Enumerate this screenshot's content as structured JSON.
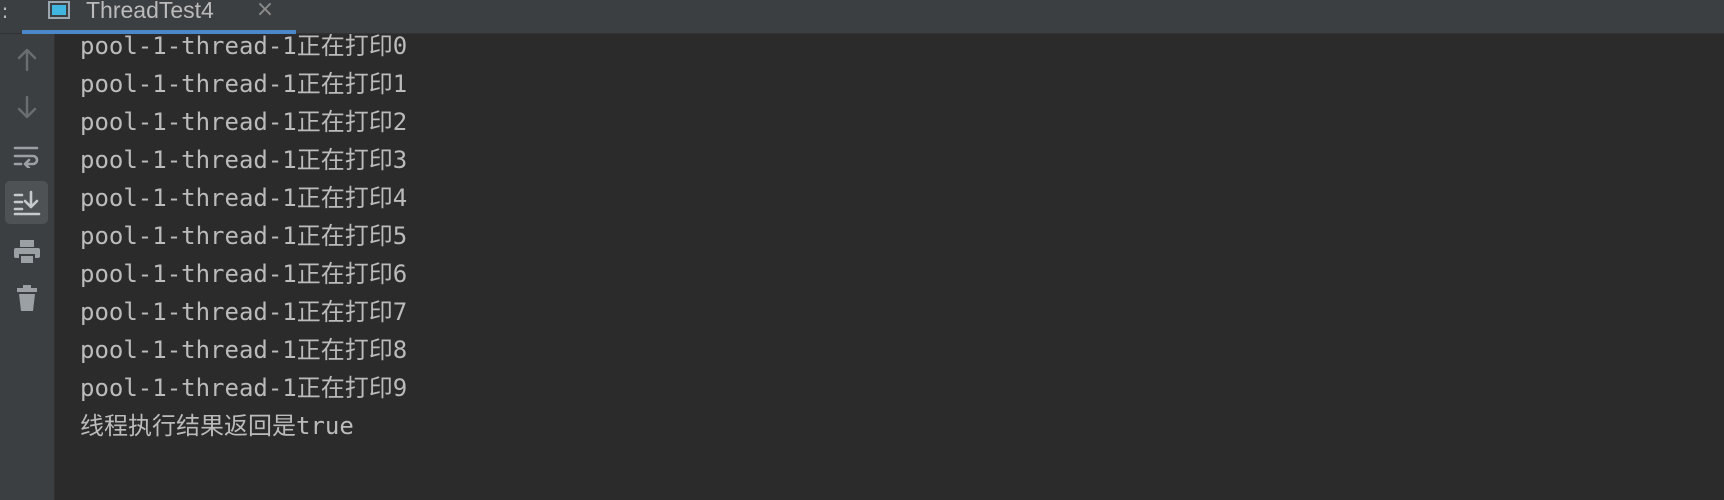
{
  "tab": {
    "title": "ThreadTest4",
    "menu_glyph": ":",
    "close_glyph": "×"
  },
  "toolbar": {
    "items": [
      {
        "icon": "up-arrow-icon",
        "label": "Up the stack trace"
      },
      {
        "icon": "down-arrow-icon",
        "label": "Down the stack trace"
      },
      {
        "icon": "soft-wrap-icon",
        "label": "Soft-Wrap"
      },
      {
        "icon": "scroll-to-end-icon",
        "label": "Scroll to the end",
        "active": true
      },
      {
        "icon": "print-icon",
        "label": "Print"
      },
      {
        "icon": "trash-icon",
        "label": "Clear All"
      }
    ]
  },
  "console": {
    "lines": [
      "pool-1-thread-1正在打印0",
      "pool-1-thread-1正在打印1",
      "pool-1-thread-1正在打印2",
      "pool-1-thread-1正在打印3",
      "pool-1-thread-1正在打印4",
      "pool-1-thread-1正在打印5",
      "pool-1-thread-1正在打印6",
      "pool-1-thread-1正在打印7",
      "pool-1-thread-1正在打印8",
      "pool-1-thread-1正在打印9",
      "线程执行结果返回是true"
    ]
  },
  "colors": {
    "background": "#2b2b2b",
    "panel": "#3c3f41",
    "text": "#bbbbbb",
    "icon": "#8c8c8c",
    "accent": "#4a88c7"
  }
}
